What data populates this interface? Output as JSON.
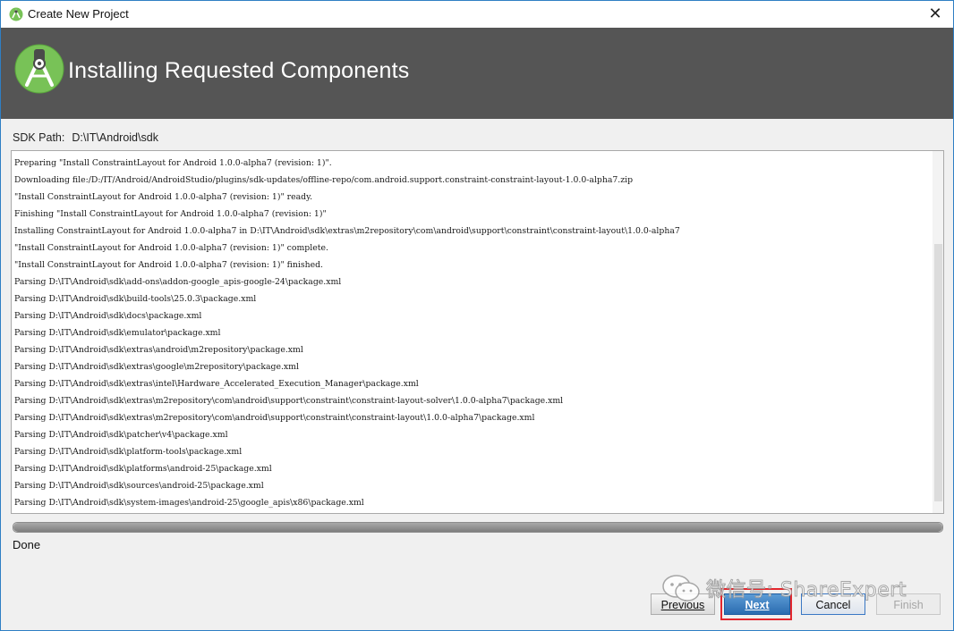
{
  "window": {
    "title": "Create New Project",
    "close_label": "✕"
  },
  "header": {
    "title": "Installing Requested Components"
  },
  "sdk": {
    "label": "SDK Path:",
    "value": "D:\\IT\\Android\\sdk"
  },
  "log": {
    "lines": [
      "Preparing \"Install ConstraintLayout for Android 1.0.0-alpha7 (revision: 1)\".",
      "Downloading file:/D:/IT/Android/AndroidStudio/plugins/sdk-updates/offline-repo/com.android.support.constraint-constraint-layout-1.0.0-alpha7.zip",
      "\"Install ConstraintLayout for Android 1.0.0-alpha7 (revision: 1)\" ready.",
      "Finishing \"Install ConstraintLayout for Android 1.0.0-alpha7 (revision: 1)\"",
      "Installing ConstraintLayout for Android 1.0.0-alpha7 in D:\\IT\\Android\\sdk\\extras\\m2repository\\com\\android\\support\\constraint\\constraint-layout\\1.0.0-alpha7",
      "\"Install ConstraintLayout for Android 1.0.0-alpha7 (revision: 1)\" complete.",
      "\"Install ConstraintLayout for Android 1.0.0-alpha7 (revision: 1)\" finished.",
      "Parsing D:\\IT\\Android\\sdk\\add-ons\\addon-google_apis-google-24\\package.xml",
      "Parsing D:\\IT\\Android\\sdk\\build-tools\\25.0.3\\package.xml",
      "Parsing D:\\IT\\Android\\sdk\\docs\\package.xml",
      "Parsing D:\\IT\\Android\\sdk\\emulator\\package.xml",
      "Parsing D:\\IT\\Android\\sdk\\extras\\android\\m2repository\\package.xml",
      "Parsing D:\\IT\\Android\\sdk\\extras\\google\\m2repository\\package.xml",
      "Parsing D:\\IT\\Android\\sdk\\extras\\intel\\Hardware_Accelerated_Execution_Manager\\package.xml",
      "Parsing D:\\IT\\Android\\sdk\\extras\\m2repository\\com\\android\\support\\constraint\\constraint-layout-solver\\1.0.0-alpha7\\package.xml",
      "Parsing D:\\IT\\Android\\sdk\\extras\\m2repository\\com\\android\\support\\constraint\\constraint-layout\\1.0.0-alpha7\\package.xml",
      "Parsing D:\\IT\\Android\\sdk\\patcher\\v4\\package.xml",
      "Parsing D:\\IT\\Android\\sdk\\platform-tools\\package.xml",
      "Parsing D:\\IT\\Android\\sdk\\platforms\\android-25\\package.xml",
      "Parsing D:\\IT\\Android\\sdk\\sources\\android-25\\package.xml",
      "Parsing D:\\IT\\Android\\sdk\\system-images\\android-25\\google_apis\\x86\\package.xml"
    ]
  },
  "progress": {
    "fraction": 1.0
  },
  "status": {
    "text": "Done"
  },
  "buttons": {
    "previous": "Previous",
    "next": "Next",
    "cancel": "Cancel",
    "finish": "Finish"
  },
  "watermark": {
    "text": "微信号: ShareExpert"
  },
  "colors": {
    "header_bg": "#555555",
    "accent_blue": "#2b6cb0",
    "highlight_red": "#e3272d",
    "android_green": "#78c257"
  }
}
